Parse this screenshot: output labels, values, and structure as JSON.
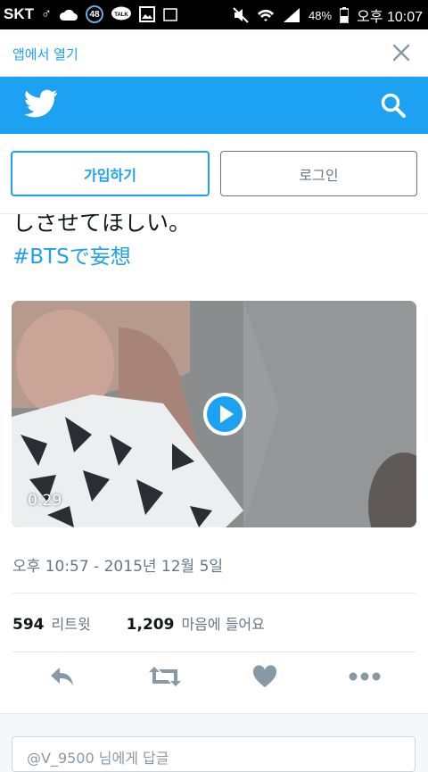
{
  "status_bar": {
    "carrier": "SKT",
    "badge_count": "48",
    "battery": "48%",
    "time": "오후 10:07"
  },
  "open_app_banner": {
    "label": "앱에서 열기"
  },
  "auth": {
    "signup_label": "가입하기",
    "login_label": "로그인"
  },
  "tweet": {
    "text_line": "しさせてほしい。",
    "hashtag": "#BTSで妄想",
    "video_duration": "0:29",
    "timestamp": "오후 10:57 - 2015년 12월 5일",
    "retweets": {
      "count": "594",
      "label": "리트윗"
    },
    "likes": {
      "count": "1,209",
      "label": "마음에 들어요"
    }
  },
  "reply": {
    "placeholder": "@V_9500 님에게 답글"
  },
  "colors": {
    "brand": "#1da1f2",
    "gray": "#657786",
    "icon": "#8899a6"
  },
  "icons": [
    "twitter-bird-icon",
    "search-icon",
    "close-icon",
    "play-icon",
    "reply-icon",
    "retweet-icon",
    "heart-icon",
    "more-icon"
  ]
}
